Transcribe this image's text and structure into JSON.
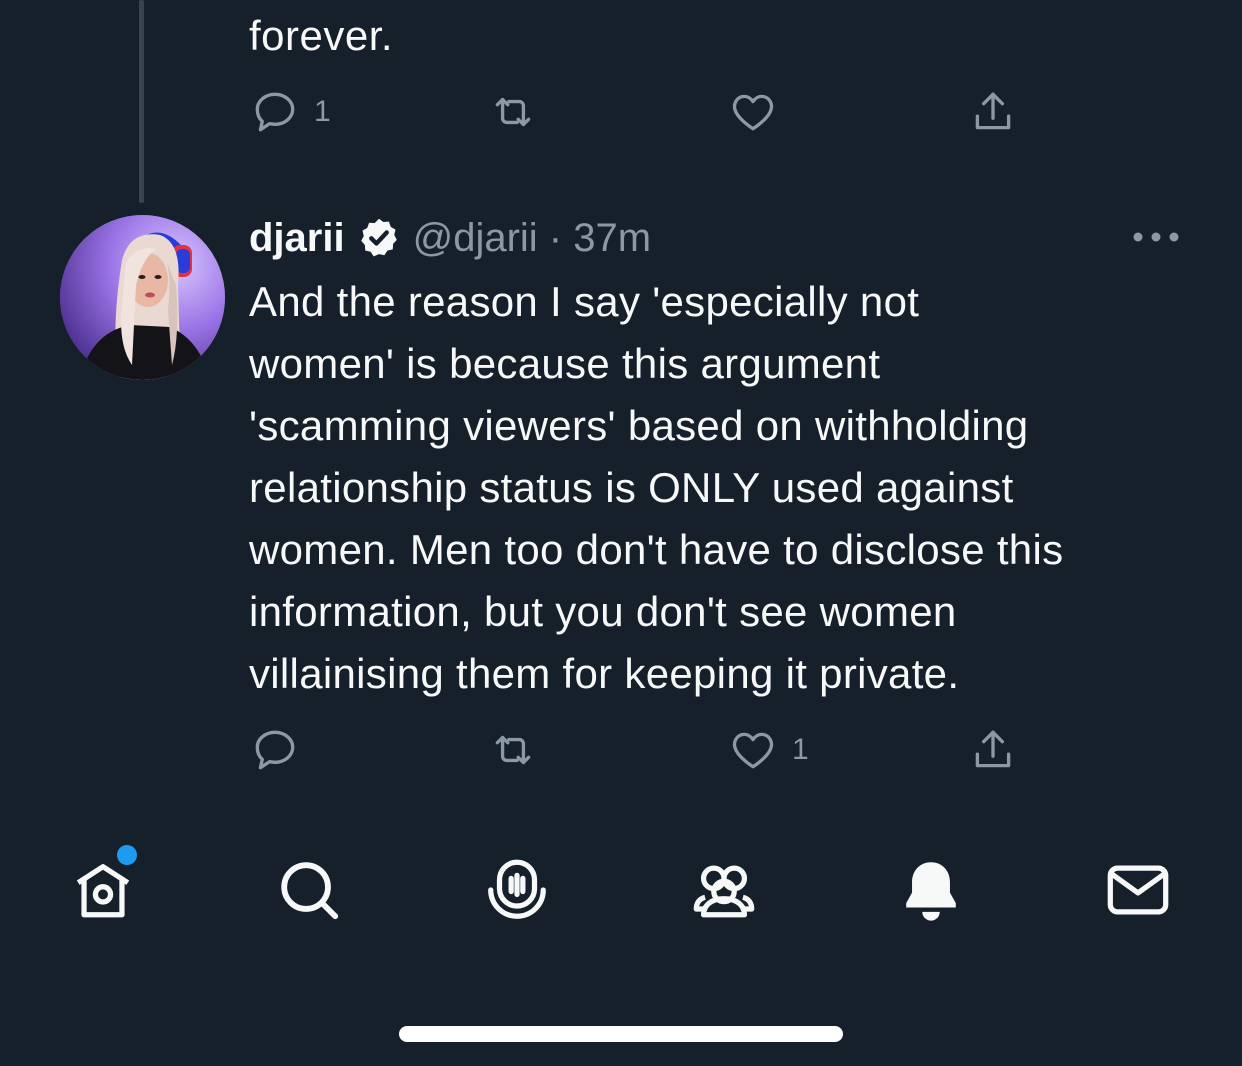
{
  "previous_tweet": {
    "text_tail": "forever.",
    "actions": {
      "reply_count": "1",
      "retweet_count": "",
      "like_count": "",
      "share_icon": "share-icon"
    }
  },
  "tweet": {
    "display_name": "djarii",
    "verified": true,
    "handle_time": "@djarii · 37m",
    "text": "And the reason I say 'especially not\nwomen' is because this argument\n'scamming viewers' based on withholding\nrelationship status is ONLY used against\nwomen. Men too don't have to disclose this\ninformation, but you don't see women\nvillainising them for keeping it private.",
    "actions": {
      "reply_count": "",
      "retweet_count": "",
      "like_count": "1"
    }
  },
  "bottom_nav": {
    "items": [
      "home-icon",
      "search-icon",
      "spaces-icon",
      "communities-icon",
      "notifications-icon",
      "messages-icon"
    ],
    "home_has_new": true
  },
  "colors": {
    "background": "#15202b",
    "text": "#f7f9f9",
    "secondary": "#8b98a5",
    "accent": "#1d9bf0"
  }
}
